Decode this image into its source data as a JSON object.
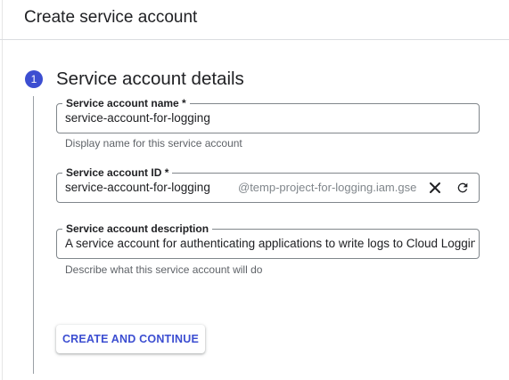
{
  "header": {
    "title": "Create service account"
  },
  "step": {
    "number": "1",
    "title": "Service account details"
  },
  "fields": {
    "name": {
      "label": "Service account name *",
      "value": "service-account-for-logging",
      "hint": "Display name for this service account"
    },
    "id": {
      "label": "Service account ID *",
      "value": "service-account-for-logging",
      "suffix": "@temp-project-for-logging.iam.gse",
      "clear_icon": "close-icon",
      "refresh_icon": "refresh-icon"
    },
    "description": {
      "label": "Service account description",
      "value": "A service account for authenticating applications to write logs to Cloud Logging",
      "hint": "Describe what this service account will do"
    }
  },
  "actions": {
    "create_label": "CREATE AND CONTINUE"
  },
  "colors": {
    "accent": "#3c4ed1",
    "text": "#202124",
    "hint": "#5f6368",
    "border": "#80868b"
  }
}
